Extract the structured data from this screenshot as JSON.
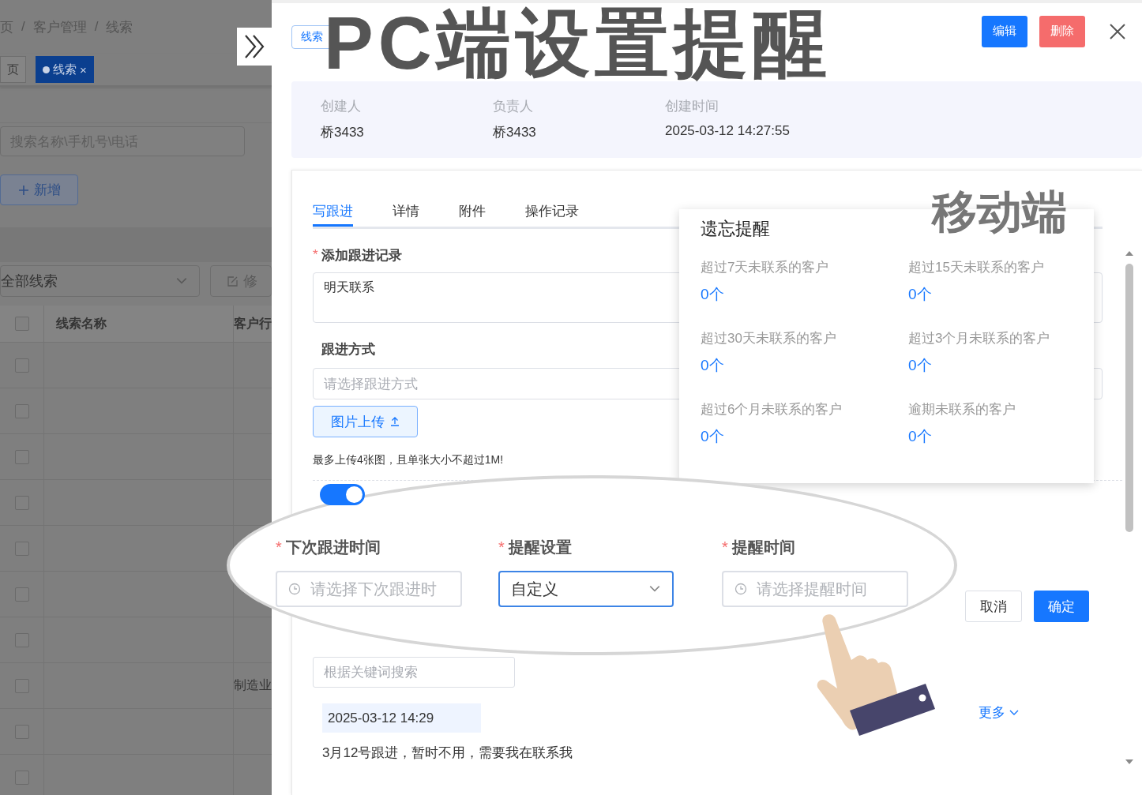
{
  "background_page": {
    "breadcrumb": [
      "页",
      "客户管理",
      "线索"
    ],
    "breadcrumb_separator": "/",
    "tabs": [
      {
        "label": "页",
        "selected": false
      },
      {
        "label": "线索",
        "selected": true,
        "close": "×"
      }
    ],
    "search": {
      "placeholder": "搜索名称\\手机号\\电话"
    },
    "add_button": "新增",
    "filter_select": {
      "value": "全部线索"
    },
    "edit_button": "修",
    "table": {
      "columns": [
        "线索名称",
        "客户行"
      ],
      "header_checked": false,
      "rows": [
        {
          "checked": false
        },
        {
          "checked": false
        },
        {
          "checked": false
        },
        {
          "checked": false
        },
        {
          "checked": false
        },
        {
          "checked": false
        },
        {
          "checked": false
        },
        {
          "checked": false,
          "column_2": "制造业"
        },
        {
          "checked": false
        },
        {
          "checked": false
        }
      ]
    }
  },
  "drawer": {
    "tag": "线索",
    "buttons": [
      {
        "label": "编辑",
        "kind": "primary"
      },
      {
        "label": "删除",
        "kind": "danger"
      }
    ],
    "info": [
      {
        "label": "创建人",
        "value": "桥3433"
      },
      {
        "label": "负责人",
        "value": "桥3433"
      },
      {
        "label": "创建时间",
        "value": "2025-03-12 14:27:55"
      }
    ],
    "tabs": [
      {
        "label": "写跟进",
        "selected": true
      },
      {
        "label": "详情",
        "selected": false
      },
      {
        "label": "附件",
        "selected": false
      },
      {
        "label": "操作记录",
        "selected": false
      }
    ],
    "required_mark": "*",
    "form": [
      {
        "label": "添加跟进记录",
        "required": true,
        "kind": "textarea",
        "value": "明天联系"
      },
      {
        "label": "跟进方式",
        "required": false,
        "kind": "select",
        "placeholder": "请选择跟进方式"
      }
    ],
    "upload_button": "图片上传",
    "upload_hint": "最多上传4张图，且单张大小不超过1M!",
    "reminder_switch": {
      "on": true
    },
    "dialog_buttons": [
      {
        "label": "取消",
        "kind": "default"
      },
      {
        "label": "确定",
        "kind": "primary"
      }
    ],
    "search": {
      "placeholder": "根据关键词搜索"
    },
    "records": [
      {
        "time": "2025-03-12 14:29",
        "text": "3月12号跟进，暂时不用，需要我在联系我"
      }
    ],
    "more_link": "更多"
  },
  "reminder_popover": {
    "title": "遗忘提醒",
    "items": [
      {
        "label": "超过7天未联系的客户",
        "count": "0个"
      },
      {
        "label": "超过15天未联系的客户",
        "count": "0个"
      },
      {
        "label": "超过30天未联系的客户",
        "count": "0个"
      },
      {
        "label": "超过3个月未联系的客户",
        "count": "0个"
      },
      {
        "label": "超过6个月未联系的客户",
        "count": "0个"
      },
      {
        "label": "逾期未联系的客户",
        "count": "0个"
      }
    ]
  },
  "lens": {
    "required_mark": "*",
    "fields": [
      {
        "label": "下次跟进时间",
        "required": true,
        "kind": "date",
        "placeholder": "请选择下次跟进时",
        "focused": false
      },
      {
        "label": "提醒设置",
        "required": true,
        "kind": "select",
        "value": "自定义",
        "focused": true
      },
      {
        "label": "提醒时间",
        "required": true,
        "kind": "date",
        "placeholder": "请选择提醒时间",
        "focused": false
      }
    ]
  },
  "captions": [
    {
      "text": "PC端设置提醒",
      "kind": "pc"
    },
    {
      "text": "移动端",
      "kind": "mobile"
    }
  ]
}
